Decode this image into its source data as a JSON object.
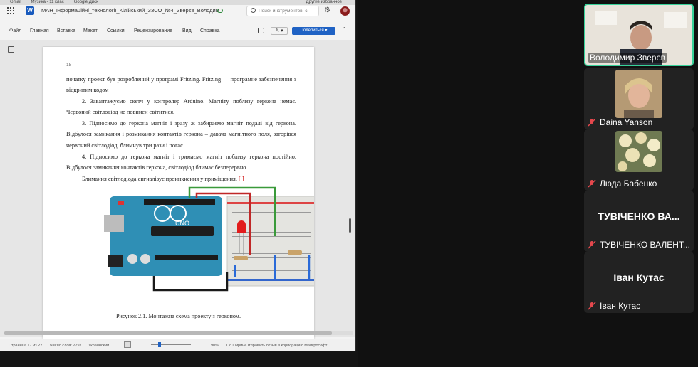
{
  "browser": {
    "bookmarks": [
      "Gmail",
      "Музика - 11 клас",
      "Google Диск"
    ],
    "bookmarks_right": "Другие избранное"
  },
  "word": {
    "doc_title": "МАН_Інформаційні_технології_Кілійський_ЗЗСО_№4_Зверєв_Володимир",
    "search_placeholder": "Поиск инструментов, с",
    "menu": [
      "Файл",
      "Главная",
      "Вставка",
      "Макет",
      "Ссылки",
      "Рецензирование",
      "Вид",
      "Справка"
    ],
    "edit_label": "✎ ▾",
    "share_label": "Поделиться ▾",
    "page_number": "18",
    "paragraphs": [
      "початку проект був розроблений у програмі Fritzing. Fritzing — програмне забезпечення з відкритим кодом",
      "2. Завантажуємо скетч у контролер Arduino. Магніту поблизу геркона немає. Червоний світлодіод не повинен світитися.",
      "3. Підносимо до геркона магніт і зразу ж забираємо магніт подалі від геркона. Відбулося замикання і розмикання контактів геркона – давача магнітного поля, загорівся червоний світлодіод, блимнув три рази і погас.",
      "4. Підносимо до геркона магніт і тримаємо магніт поблизу геркона постійно. Відбулося замикання контактів геркона, світлодіод блимає безперервно.",
      "Блимання світлодіода сигналізує проникнення у приміщення."
    ],
    "citation": "[ ]",
    "caption": "Рисунок 2.1. Монтажна схема проекту з герконом.",
    "board_label": "UNO",
    "status": {
      "page": "Страница 17 из 22",
      "words": "Число слов: 2797",
      "language": "Украинский",
      "zoom": "90%",
      "fit": "По ширине",
      "feedback": "Отправить отзыв в корпорацию Майкрософт"
    }
  },
  "participants": [
    {
      "name": "Володимир Зверєв",
      "active": true,
      "muted": false,
      "video": true
    },
    {
      "name": "Daina Yanson",
      "muted": true,
      "video": true
    },
    {
      "name": "Люда Бабенко",
      "muted": true,
      "video": true
    },
    {
      "name": "ТУВІЧЕНКО ВАЛЕНТ...",
      "display": "ТУВІЧЕНКО ВА...",
      "muted": true,
      "video": false
    },
    {
      "name": "Іван Кутас",
      "display": "Іван Кутас",
      "muted": true,
      "video": false
    }
  ],
  "colors": {
    "accent": "#1f62c4",
    "active_speaker": "#38d29a",
    "muted": "#e5484d"
  }
}
